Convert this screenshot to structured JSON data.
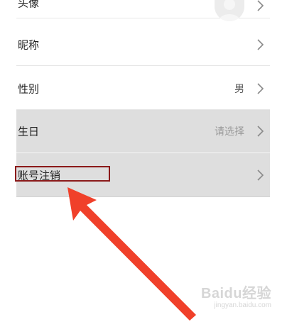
{
  "rows": {
    "avatar": {
      "label": "头像"
    },
    "nickname": {
      "label": "昵称"
    },
    "gender": {
      "label": "性别",
      "value": "男"
    },
    "birthday": {
      "label": "生日",
      "value": "请选择"
    },
    "cancel_account": {
      "label": "账号注销"
    }
  },
  "watermark": {
    "brand": "Baidu经验",
    "url": "jingyan.baidu.com"
  },
  "colors": {
    "accent_arrow": "#f0402a",
    "highlight_box": "#8b1a1a",
    "row_highlight_bg": "#dedede"
  }
}
